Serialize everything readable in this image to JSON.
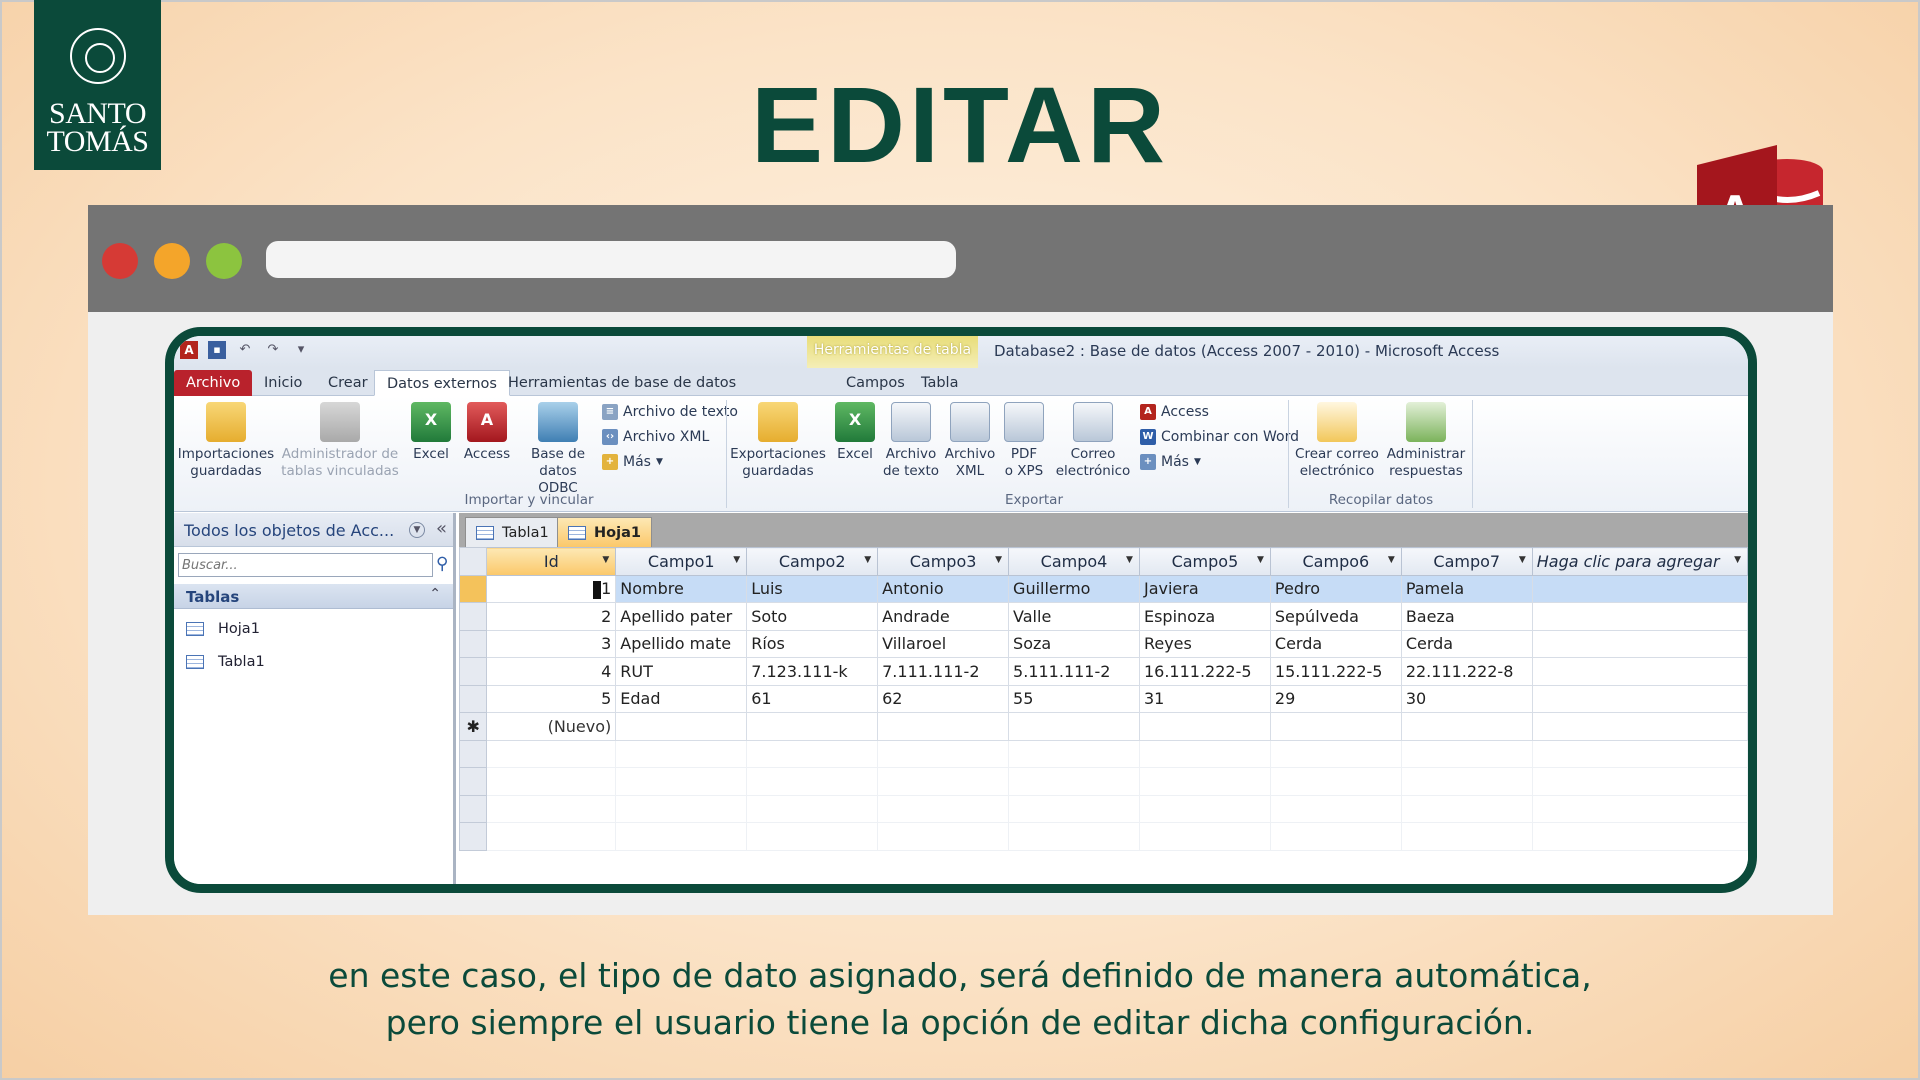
{
  "logo": {
    "line1": "SANTO",
    "line2": "TOMÁS"
  },
  "slide_title": "EDITAR",
  "access_logo_letter": "A",
  "colors": {
    "brand_green": "#0b4a3a",
    "access_red": "#b9222c"
  },
  "app": {
    "window_title": "Database2 : Base de datos (Access 2007 - 2010)  -  Microsoft Access",
    "contextual_tools": "Herramientas de tabla",
    "tabs": [
      "Archivo",
      "Inicio",
      "Crear",
      "Datos externos",
      "Herramientas de base de datos",
      "Campos",
      "Tabla"
    ],
    "ribbon": {
      "import": {
        "saved_imports": [
          "Importaciones",
          "guardadas"
        ],
        "linked_tables": [
          "Administrador de",
          "tablas vinculadas"
        ],
        "excel": "Excel",
        "access": "Access",
        "odbc": [
          "Base de",
          "datos ODBC"
        ],
        "text_file": "Archivo de texto",
        "xml_file": "Archivo XML",
        "more": "Más",
        "group_label": "Importar y vincular"
      },
      "export": {
        "saved_exports": [
          "Exportaciones",
          "guardadas"
        ],
        "excel": "Excel",
        "text_file": [
          "Archivo",
          "de texto"
        ],
        "xml_file": [
          "Archivo",
          "XML"
        ],
        "pdf": [
          "PDF",
          "o XPS"
        ],
        "email": [
          "Correo",
          "electrónico"
        ],
        "access": "Access",
        "word_merge": "Combinar con Word",
        "more": "Más",
        "group_label": "Exportar"
      },
      "collect": {
        "create_email": [
          "Crear correo",
          "electrónico"
        ],
        "manage_replies": [
          "Administrar",
          "respuestas"
        ],
        "group_label": "Recopilar datos"
      }
    },
    "nav": {
      "header": "Todos los objetos de Acc...",
      "search_placeholder": "Buscar...",
      "group": "Tablas",
      "items": [
        "Hoja1",
        "Tabla1"
      ]
    },
    "doc_tabs": [
      "Tabla1",
      "Hoja1"
    ],
    "grid": {
      "columns": [
        "Id",
        "Campo1",
        "Campo2",
        "Campo3",
        "Campo4",
        "Campo5",
        "Campo6",
        "Campo7",
        "Haga clic para agregar"
      ],
      "rows": [
        {
          "id": "1",
          "cells": [
            "Nombre",
            "Luis",
            "Antonio",
            "Guillermo",
            "Javiera",
            "Pedro",
            "Pamela"
          ]
        },
        {
          "id": "2",
          "cells": [
            "Apellido pater",
            "Soto",
            "Andrade",
            "Valle",
            "Espinoza",
            "Sepúlveda",
            "Baeza"
          ]
        },
        {
          "id": "3",
          "cells": [
            "Apellido mate",
            "Ríos",
            "Villaroel",
            "Soza",
            "Reyes",
            "Cerda",
            "Cerda"
          ]
        },
        {
          "id": "4",
          "cells": [
            "RUT",
            "7.123.111-k",
            "7.111.111-2",
            "5.111.111-2",
            "16.111.222-5",
            "15.111.222-5",
            "22.111.222-8"
          ]
        },
        {
          "id": "5",
          "cells": [
            "Edad",
            "61",
            "62",
            "55",
            "31",
            "29",
            "30"
          ]
        }
      ],
      "new_row_marker": "✱",
      "new_row_label": "(Nuevo)"
    }
  },
  "caption": {
    "line1": "en este caso, el tipo de dato asignado, será definido de manera automática,",
    "line2": "pero siempre el usuario tiene la opción de editar dicha configuración."
  }
}
